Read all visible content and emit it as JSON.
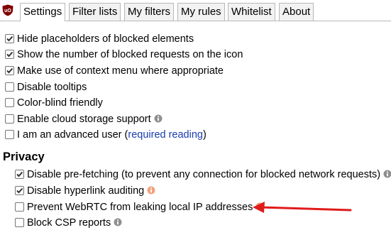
{
  "tabs": [
    {
      "label": "Settings",
      "active": true
    },
    {
      "label": "Filter lists",
      "active": false
    },
    {
      "label": "My filters",
      "active": false
    },
    {
      "label": "My rules",
      "active": false
    },
    {
      "label": "Whitelist",
      "active": false
    },
    {
      "label": "About",
      "active": false
    }
  ],
  "general_options": [
    {
      "label": "Hide placeholders of blocked elements",
      "checked": true
    },
    {
      "label": "Show the number of blocked requests on the icon",
      "checked": true
    },
    {
      "label": "Make use of context menu where appropriate",
      "checked": true
    },
    {
      "label": "Disable tooltips",
      "checked": false
    },
    {
      "label": "Color-blind friendly",
      "checked": false
    },
    {
      "label": "Enable cloud storage support",
      "checked": false,
      "info": "gray"
    },
    {
      "label": "I am an advanced user",
      "checked": false,
      "link_prefix": " (",
      "link_text": "required reading",
      "link_suffix": ")"
    }
  ],
  "privacy": {
    "title": "Privacy",
    "options": [
      {
        "label": "Disable pre-fetching (to prevent any connection for blocked network requests)",
        "checked": true,
        "info": "gray"
      },
      {
        "label": "Disable hyperlink auditing",
        "checked": true,
        "info": "orange"
      },
      {
        "label": "Prevent WebRTC from leaking local IP addresses",
        "checked": false,
        "info": "orange"
      },
      {
        "label": "Block CSP reports",
        "checked": false,
        "info": "gray"
      }
    ]
  },
  "colors": {
    "info_gray": "#8f8f8f",
    "info_orange": "#f0a27e",
    "arrow_red": "#e01b1b",
    "logo_red": "#800000",
    "link": "#1a3cb0"
  }
}
